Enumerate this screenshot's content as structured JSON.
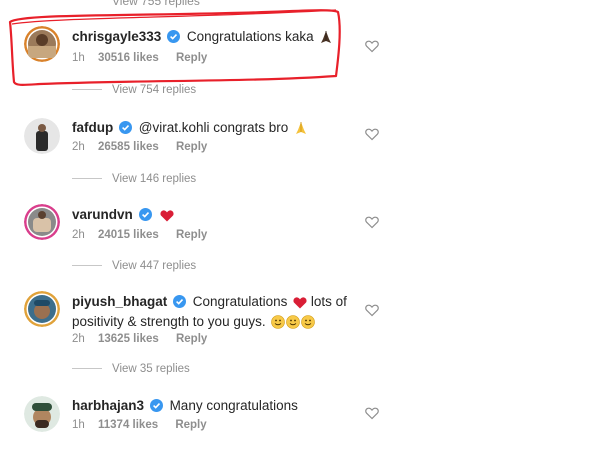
{
  "top_cut_text": "View 755 replies",
  "comments": [
    {
      "username": "chrisgayle333",
      "text": "Congratulations kaka",
      "time": "1h",
      "likes": "30516 likes",
      "reply": "Reply",
      "view_replies": "View 754 replies",
      "emoji": "folded-hands-dark-icon"
    },
    {
      "username": "fafdup",
      "text": "@virat.kohli congrats bro",
      "time": "2h",
      "likes": "26585 likes",
      "reply": "Reply",
      "view_replies": "View 146 replies",
      "emoji": "folded-hands-icon"
    },
    {
      "username": "varundvn",
      "text": "",
      "time": "2h",
      "likes": "24015 likes",
      "reply": "Reply",
      "view_replies": "View 447 replies",
      "emoji": "red-heart-icon"
    },
    {
      "username": "piyush_bhagat",
      "text_line1": "Congratulations",
      "text_line1b": "lots of",
      "text_line2": "positivity & strength to you guys.",
      "time": "2h",
      "likes": "13625 likes",
      "reply": "Reply",
      "view_replies": "View 35 replies"
    },
    {
      "username": "harbhajan3",
      "text": "Many congratulations",
      "time": "1h",
      "likes": "11374 likes",
      "reply": "Reply"
    }
  ],
  "colors": {
    "text": "#262626",
    "muted": "#8e8e8e",
    "verified": "#3897f0",
    "highlight": "#e8202a",
    "heart": "#e0245e"
  }
}
